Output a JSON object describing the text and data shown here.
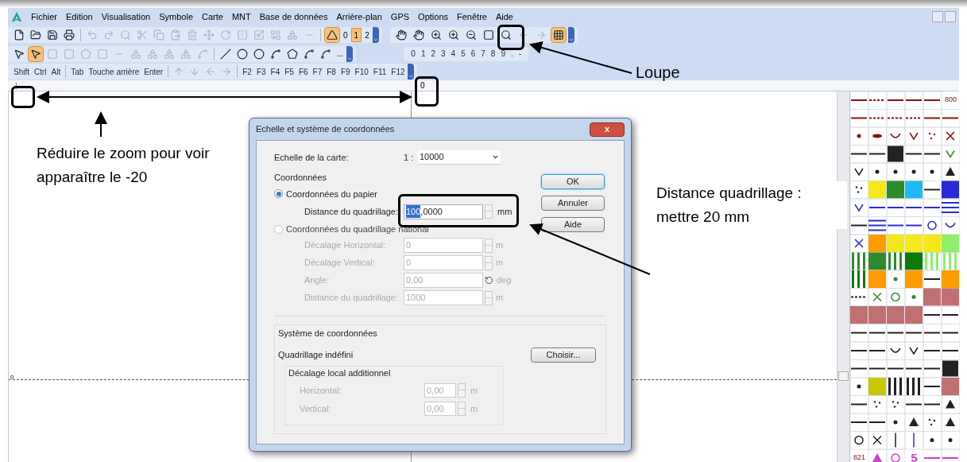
{
  "menu": [
    "Fichier",
    "Edition",
    "Visualisation",
    "Symbole",
    "Carte",
    "MNT",
    "Base de données",
    "Arrière-plan",
    "GPS",
    "Options",
    "Fenêtre",
    "Aide"
  ],
  "toolbar_main": {
    "mode_selected": true,
    "levels": [
      {
        "label": "0",
        "selected": false
      },
      {
        "label": "1",
        "selected": true
      },
      {
        "label": "2",
        "selected": false
      }
    ]
  },
  "toolbar_view": {
    "grid_selected": true
  },
  "toolbar_draw": {
    "edit_point_selected": true,
    "more": "...",
    "keypad": [
      "0",
      "1",
      "2",
      "3",
      "4",
      "5",
      "6",
      "7",
      "8",
      "9",
      ".",
      "-"
    ]
  },
  "keys": {
    "modifiers": [
      "Shift",
      "Ctrl",
      "Alt"
    ],
    "editing": [
      "Tab",
      "Touche arrière",
      "Enter"
    ],
    "function": [
      "F2",
      "F3",
      "F4",
      "F5",
      "F6",
      "F7",
      "F8",
      "F9",
      "F10",
      "F11",
      "F12"
    ]
  },
  "ruler": {
    "label": "0"
  },
  "canvas": {
    "axis_label": "0"
  },
  "dialog": {
    "title": "Echelle et système de coordonnées",
    "close": "x",
    "scale": {
      "label": "Echelle de la carte:",
      "prefix": "1 :",
      "value": "10000"
    },
    "coords_label": "Coordonnées",
    "paper": {
      "label": "Coordonnées du papier",
      "selected": true,
      "field": {
        "label": "Distance du quadrillage:",
        "value_selected": "100",
        "value_rest": ",0000",
        "unit": "mm"
      }
    },
    "national": {
      "label": "Coordonnées du quadrillage national",
      "selected": false,
      "fields": [
        {
          "label": "Décalage Horizontal:",
          "value": "0",
          "unit": "m",
          "kind": "spin"
        },
        {
          "label": "Décalage Vertical:",
          "value": "0",
          "unit": "m",
          "kind": "spin"
        },
        {
          "label": "Angle:",
          "value": "0,00",
          "unit": "deg",
          "kind": "rotate"
        },
        {
          "label": "Distance du quadrillage:",
          "value": "1000",
          "unit": "m",
          "kind": "spin"
        }
      ]
    },
    "buttons": [
      {
        "label": "OK",
        "default": true
      },
      {
        "label": "Annuler",
        "default": false
      },
      {
        "label": "Aide",
        "default": false
      }
    ],
    "system": {
      "title": "Système de coordonnées",
      "grid": "Quadrillage indéfini",
      "choose": "Choisir...",
      "local": {
        "title": "Décalage local additionnel",
        "fields": [
          {
            "label": "Horizontal:",
            "value": "0,00",
            "unit": "m"
          },
          {
            "label": "Vertical:",
            "value": "0,00",
            "unit": "m"
          }
        ]
      }
    }
  },
  "palette": {
    "labels": [
      "800",
      "821",
      "5"
    ]
  },
  "annotations": {
    "zoom": "Loupe",
    "reduce": "Réduire le zoom pour voir apparaître le -20",
    "distance": "Distance quadrillage : mettre 20 mm"
  }
}
